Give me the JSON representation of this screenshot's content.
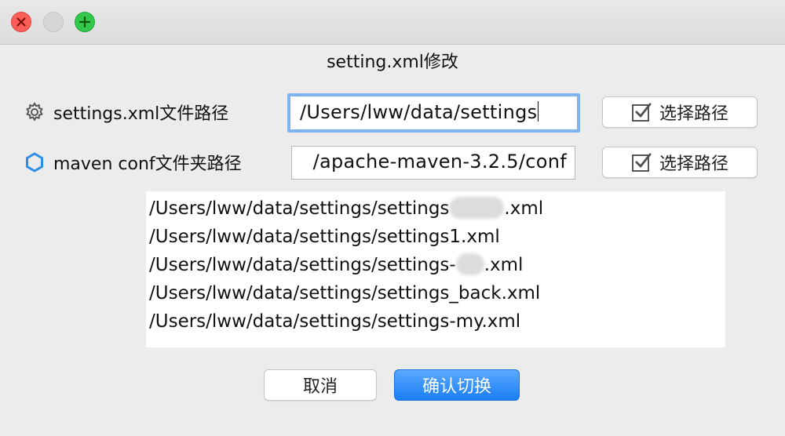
{
  "window": {
    "title": "setting.xml修改"
  },
  "settings_row": {
    "label": "settings.xml文件路径",
    "icon": "gear-icon",
    "value": "/Users/lww/data/settings",
    "button_label": "选择路径"
  },
  "maven_row": {
    "label": "maven conf文件夹路径",
    "icon": "hexagon-icon",
    "value": "/apache-maven-3.2.5/conf",
    "button_label": "选择路径"
  },
  "file_list": {
    "items": [
      {
        "prefix": "/Users/lww/data/settings/settings",
        "suffix": ".xml"
      },
      {
        "prefix": "/Users/lww/data/settings/settings1.xml",
        "suffix": ""
      },
      {
        "prefix": "/Users/lww/data/settings/settings-",
        "suffix": ".xml"
      },
      {
        "prefix": "/Users/lww/data/settings/settings_back.xml",
        "suffix": ""
      },
      {
        "prefix": "/Users/lww/data/settings/settings-my.xml",
        "suffix": ""
      }
    ]
  },
  "actions": {
    "cancel_label": "取消",
    "confirm_label": "确认切换"
  },
  "colors": {
    "accent": "#1a7ef5",
    "focus_ring": "#7fb3f0",
    "hexagon_icon": "#2a8de8"
  }
}
